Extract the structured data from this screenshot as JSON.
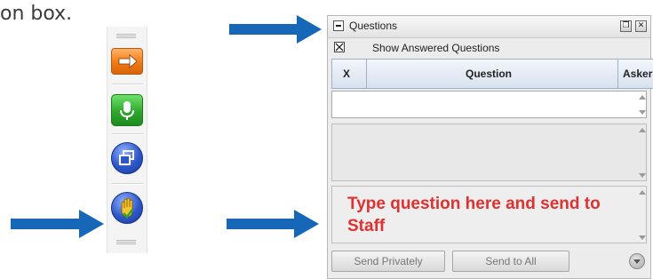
{
  "page": {
    "fragment": "on box."
  },
  "questions_panel": {
    "title": "Questions",
    "show_answered_label": "Show Answered Questions",
    "columns": {
      "x": "X",
      "question": "Question",
      "asker": "Asker"
    },
    "input_placeholder": "Type question here and send to Staff",
    "buttons": {
      "send_privately": "Send Privately",
      "send_to_all": "Send to All"
    }
  },
  "toolbar": {
    "icons": [
      "arrow-right-icon",
      "microphone-icon",
      "windows-icon",
      "raise-hand-icon"
    ]
  },
  "colors": {
    "arrow": "#1767b8",
    "input_text": "#e03030",
    "orange_button": "#f07a12",
    "green_button": "#2ea82e",
    "blue_button": "#2d57c8"
  }
}
